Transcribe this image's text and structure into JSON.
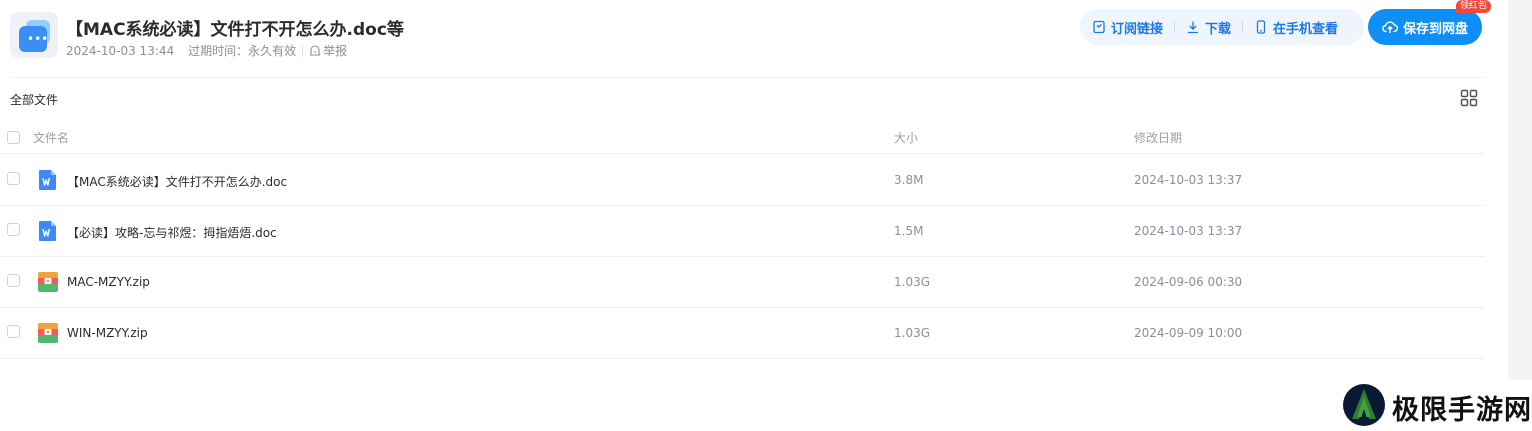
{
  "share": {
    "title": "【MAC系统必读】文件打不开怎么办.doc等",
    "date": "2024-10-03 13:44",
    "expiry_label": "过期时间：",
    "expiry_value": "永久有效",
    "report_label": "举报"
  },
  "actions": {
    "subscribe_label": "订阅链接",
    "download_label": "下载",
    "mobile_label": "在手机查看",
    "save_label": "保存到网盘",
    "redpacket_label": "领红包"
  },
  "breadcrumb": "全部文件",
  "table": {
    "columns": {
      "name": "文件名",
      "size": "大小",
      "modified": "修改日期"
    },
    "rows": [
      {
        "name": "【MAC系统必读】文件打不开怎么办.doc",
        "size": "3.8M",
        "date": "2024-10-03 13:37",
        "icon": "word-doc-icon"
      },
      {
        "name": "【必读】攻略-忘与祁煜：拇指焐焐.doc",
        "size": "1.5M",
        "date": "2024-10-03 13:37",
        "icon": "word-doc-icon"
      },
      {
        "name": "MAC-MZYY.zip",
        "size": "1.03G",
        "date": "2024-09-06 00:30",
        "icon": "zip-archive-icon"
      },
      {
        "name": "WIN-MZYY.zip",
        "size": "1.03G",
        "date": "2024-09-09 10:00",
        "icon": "zip-archive-icon"
      }
    ]
  },
  "watermark": {
    "text": "极限手游网"
  },
  "colors": {
    "accent": "#1f77e6",
    "save_button": "#0d8ff5",
    "badge": "#f0493e"
  }
}
